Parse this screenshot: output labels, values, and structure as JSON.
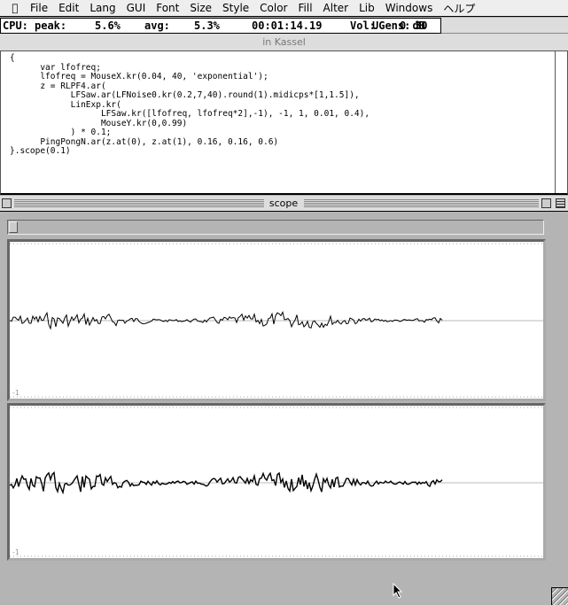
{
  "menubar": {
    "items": [
      "File",
      "Edit",
      "Lang",
      "GUI",
      "Font",
      "Size",
      "Style",
      "Color",
      "Fill",
      "Alter",
      "Lib",
      "Windows",
      "ヘルプ"
    ]
  },
  "status": {
    "cpu_label": "CPU:",
    "peak_label": "peak:",
    "peak": "5.6%",
    "avg_label": "avg:",
    "avg": "5.3%",
    "time": "00:01:14.19",
    "vol_label": "Vol:",
    "vol": "0 dB",
    "ugens_label": "UGens:",
    "ugens": "30"
  },
  "editor": {
    "title": "in Kassel",
    "code": "{\n      var lfofreq;\n      lfofreq = MouseX.kr(0.04, 40, 'exponential');\n      z = RLPF4.ar(\n            LFSaw.ar(LFNoise0.kr(0.2,7,40).round(1).midicps*[1,1.5]),\n            LinExp.kr(\n                  LFSaw.kr([lfofreq, lfofreq*2],-1), -1, 1, 0.01, 0.4),\n                  MouseY.kr(0,0.99)\n            ) * 0.1;\n      PingPongN.ar(z.at(0), z.at(1), 0.16, 0.16, 0.6)\n}.scope(0.1)"
  },
  "scope": {
    "title": "scope",
    "channels": [
      {
        "min_label": "-1"
      },
      {
        "min_label": "-1"
      }
    ]
  }
}
